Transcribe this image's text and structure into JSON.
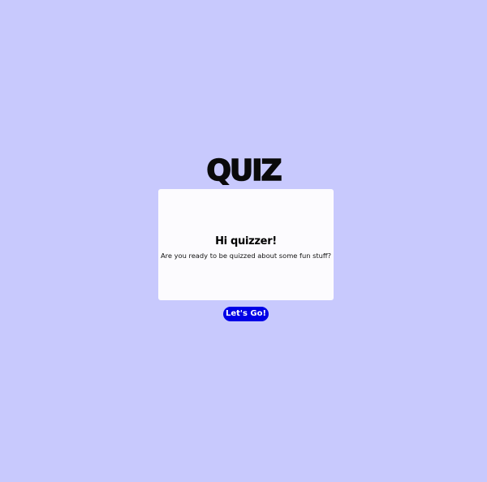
{
  "app": {
    "logo_text": "QUIZ"
  },
  "intro_card": {
    "title": "Hi quizzer!",
    "message": "Are you ready to be quizzed about some fun stuff?"
  },
  "actions": {
    "start_label": "Let's Go!"
  },
  "colors": {
    "background": "#c8c9fd",
    "card": "#fcfbfe",
    "button": "#0000e6"
  }
}
